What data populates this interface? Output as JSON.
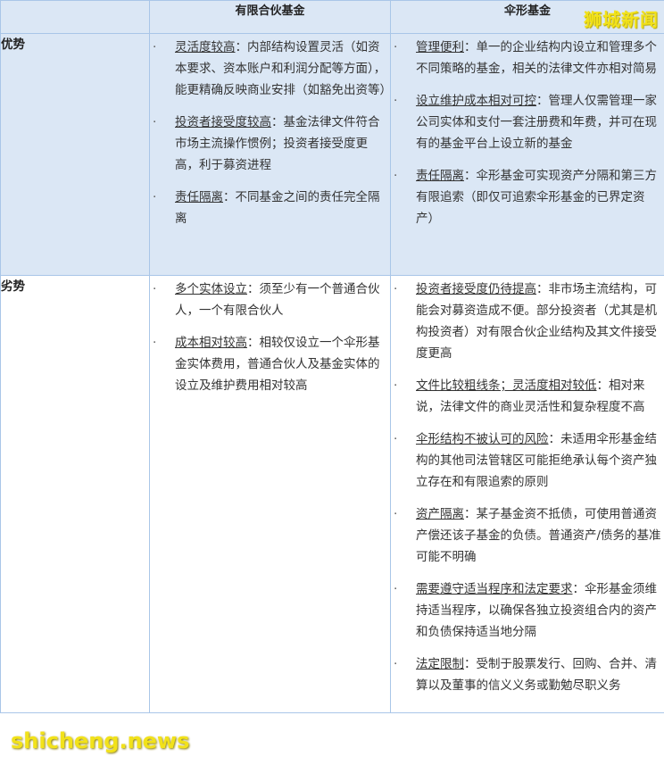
{
  "table": {
    "col_headers": [
      "有限合伙基金",
      "伞形基金"
    ],
    "rows": [
      {
        "label": "优势",
        "lp_fund": [
          {
            "term": "灵活度较高",
            "text": "：内部结构设置灵活（如资本要求、资本账户和利润分配等方面），能更精确反映商业安排（如豁免出资等）"
          },
          {
            "term": "投资者接受度较高",
            "text": "：基金法律文件符合市场主流操作惯例；投资者接受度更高，利于募资进程"
          },
          {
            "term": "责任隔离",
            "text": "：不同基金之间的责任完全隔离"
          }
        ],
        "umbrella_fund": [
          {
            "term": "管理便利",
            "text": "：单一的企业结构内设立和管理多个不同策略的基金，相关的法律文件亦相对简易"
          },
          {
            "term": "设立维护成本相对可控",
            "text": "：管理人仅需管理一家公司实体和支付一套注册费和年费，并可在现有的基金平台上设立新的基金"
          },
          {
            "term": "责任隔离",
            "text": "：伞形基金可实现资产分隔和第三方有限追索（即仅可追索伞形基金的已界定资产）"
          }
        ]
      },
      {
        "label": "劣势",
        "lp_fund": [
          {
            "term": "多个实体设立",
            "text": "：须至少有一个普通合伙人，一个有限合伙人"
          },
          {
            "term": "成本相对较高",
            "text": "：相较仅设立一个伞形基金实体费用，普通合伙人及基金实体的设立及维护费用相对较高"
          }
        ],
        "umbrella_fund": [
          {
            "term": "投资者接受度仍待提高",
            "text": "：非市场主流结构，可能会对募资造成不便。部分投资者（尤其是机构投资者）对有限合伙企业结构及其文件接受度更高"
          },
          {
            "term": "文件比较粗线条；灵活度相对较低",
            "text": "：相对来说，法律文件的商业灵活性和复杂程度不高"
          },
          {
            "term": "伞形结构不被认可的风险",
            "text": "：未适用伞形基金结构的其他司法管辖区可能拒绝承认每个资产独立存在和有限追索的原则"
          },
          {
            "term": "资产隔离",
            "text": "：某子基金资不抵债，可使用普通资产偿还该子基金的负债。普通资产/债务的基准可能不明确"
          },
          {
            "term": "需要遵守适当程序和法定要求",
            "text": "：伞形基金须维持适当程序，以确保各独立投资组合内的资产和负债保持适当地分隔"
          },
          {
            "term": "法定限制",
            "text": "：受制于股票发行、回购、合并、清算以及董事的信义义务或勤勉尽职义务"
          }
        ]
      }
    ]
  },
  "watermarks": {
    "top_right": "狮城新闻",
    "bottom_left": "shicheng.news",
    "color": "#f2e21a"
  },
  "colors": {
    "header_bg": "#dbe7f5",
    "border": "#a9c6e8"
  }
}
